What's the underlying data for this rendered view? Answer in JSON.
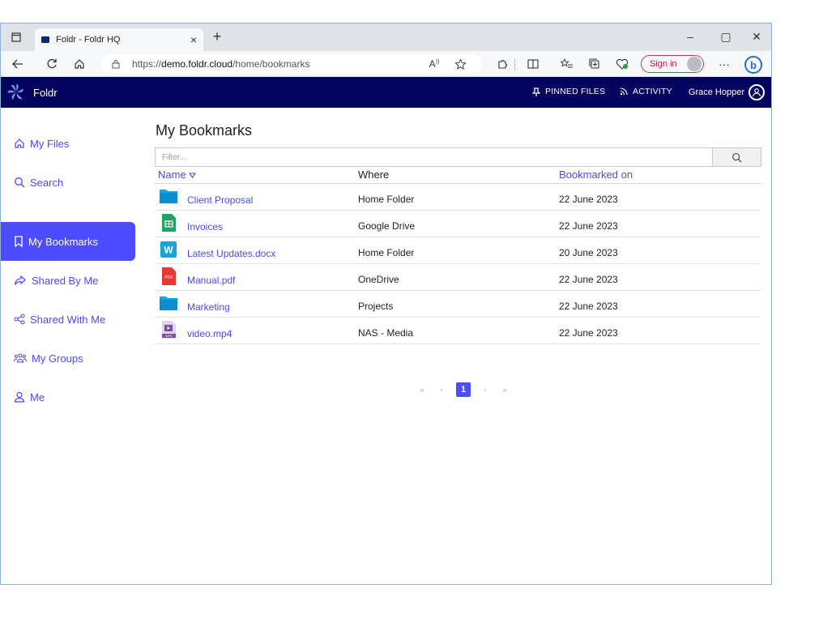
{
  "browser": {
    "tab_title": "Foldr - Foldr HQ",
    "tab_close": "×",
    "new_tab": "+",
    "url_prefix": "https://",
    "url_host": "demo.foldr.cloud",
    "url_path": "/home/bookmarks",
    "sign_in_label": "Sign in",
    "more_label": "···",
    "bing_label": "b",
    "window_controls": {
      "minimize": "–",
      "maximize": "▢",
      "close": "✕"
    }
  },
  "app": {
    "brand": "Foldr",
    "nav": {
      "pinned_files": "PINNED FILES",
      "activity": "ACTIVITY"
    },
    "user_name": "Grace Hopper",
    "accent_color": "#4d4dff",
    "header_color": "#03045e"
  },
  "sidebar": {
    "items": [
      {
        "label": "My Files",
        "icon": "home-icon",
        "active": false
      },
      {
        "label": "Search",
        "icon": "search-icon",
        "active": false
      },
      {
        "label": "My Bookmarks",
        "icon": "bookmark-icon",
        "active": true
      },
      {
        "label": "Shared By Me",
        "icon": "share-icon",
        "active": false
      },
      {
        "label": "Shared With Me",
        "icon": "share-nodes-icon",
        "active": false
      },
      {
        "label": "My Groups",
        "icon": "group-icon",
        "active": false
      },
      {
        "label": "Me",
        "icon": "user-icon",
        "active": false
      }
    ]
  },
  "main": {
    "title": "My Bookmarks",
    "filter_placeholder": "Filter...",
    "columns": {
      "name": "Name",
      "where": "Where",
      "bookmarked_on": "Bookmarked on"
    },
    "rows": [
      {
        "name": "Client Proposal",
        "where": "Home Folder",
        "date": "22 June 2023",
        "icon": "folder-icon"
      },
      {
        "name": "Invoices",
        "where": "Google Drive",
        "date": "22 June 2023",
        "icon": "google-sheets-icon"
      },
      {
        "name": "Latest Updates.docx",
        "where": "Home Folder",
        "date": "20 June 2023",
        "icon": "word-doc-icon"
      },
      {
        "name": "Manual.pdf",
        "where": "OneDrive",
        "date": "22 June 2023",
        "icon": "pdf-icon"
      },
      {
        "name": "Marketing",
        "where": "Projects",
        "date": "22 June 2023",
        "icon": "folder-icon"
      },
      {
        "name": "video.mp4",
        "where": "NAS - Media",
        "date": "22 June 2023",
        "icon": "video-file-icon"
      }
    ],
    "pagination": {
      "first": "«",
      "prev": "‹",
      "current": "1",
      "next": "›",
      "last": "»"
    },
    "file_badges": {
      "word": "W",
      "pdf": "PDF",
      "video": "MP4"
    }
  }
}
